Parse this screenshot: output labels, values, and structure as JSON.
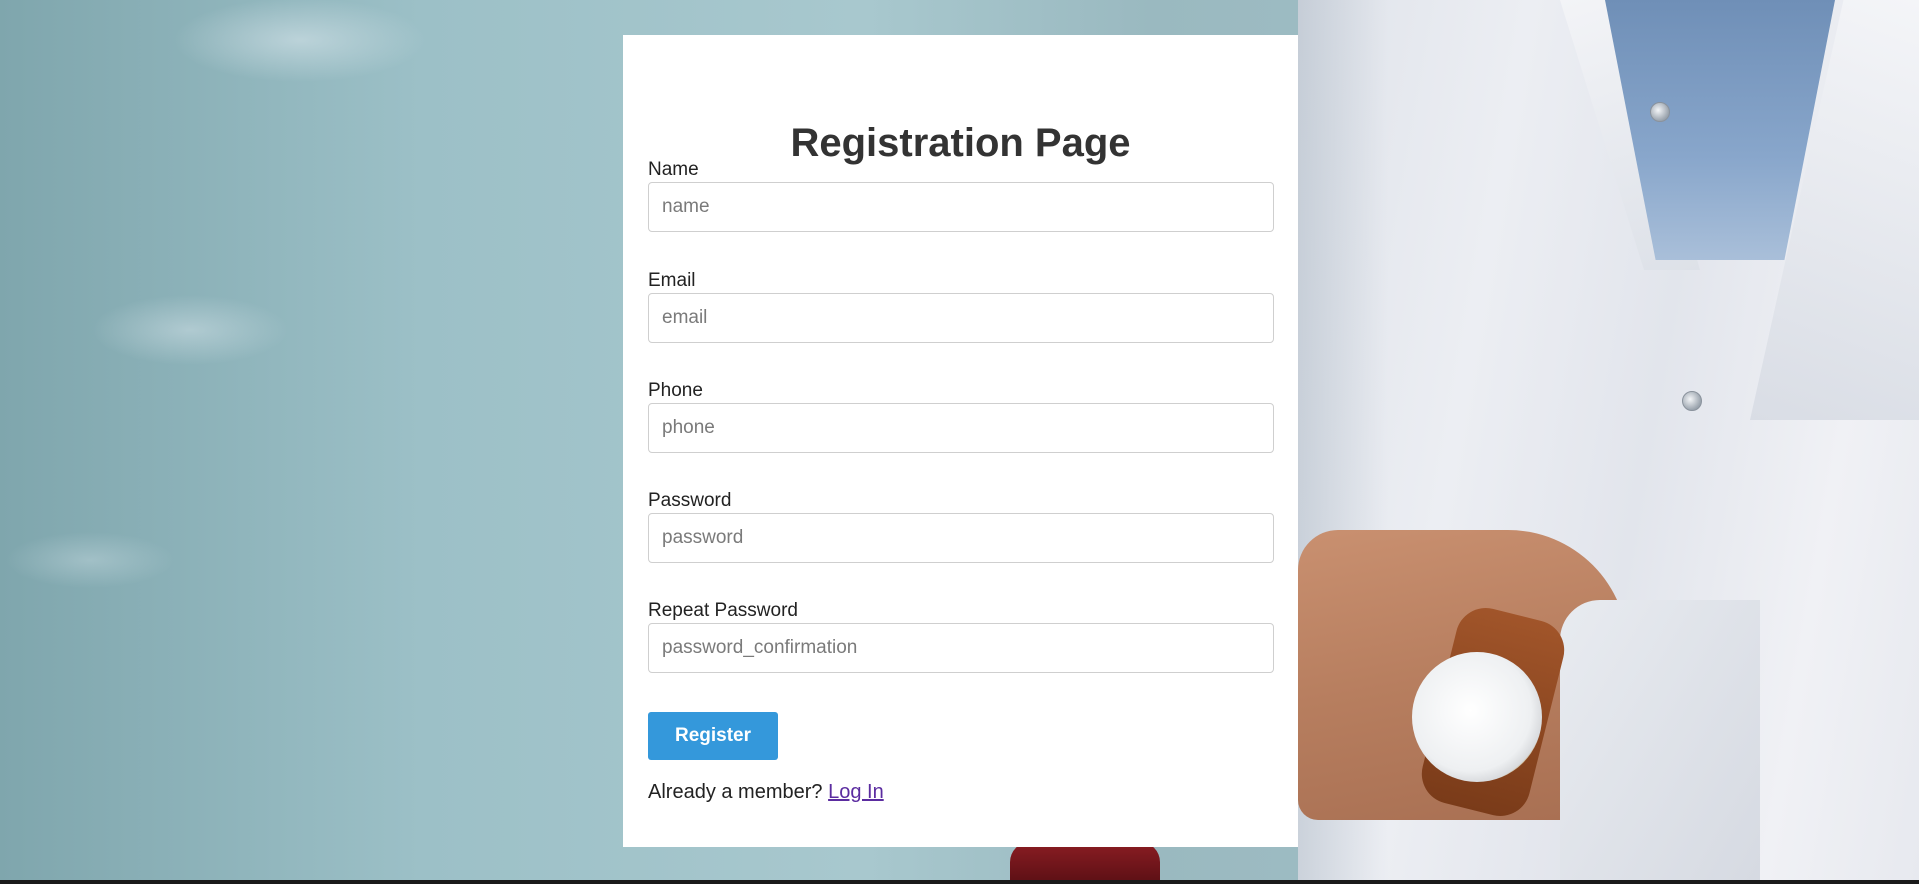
{
  "page": {
    "title": "Registration Page"
  },
  "form": {
    "fields": [
      {
        "label": "Name",
        "placeholder": "name",
        "value": ""
      },
      {
        "label": "Email",
        "placeholder": "email",
        "value": ""
      },
      {
        "label": "Phone",
        "placeholder": "phone",
        "value": ""
      },
      {
        "label": "Password",
        "placeholder": "password",
        "value": ""
      },
      {
        "label": "Repeat Password",
        "placeholder": "password_confirmation",
        "value": ""
      }
    ],
    "submit_label": "Register"
  },
  "footer": {
    "prompt_text": "Already a member?",
    "login_link": "Log In"
  },
  "colors": {
    "accent": "#3498db",
    "title": "#333333",
    "link": "#5b2ca0",
    "card_background": "#ffffff"
  },
  "icons": {
    "background_image": "doctor-in-white-coat-photo"
  }
}
